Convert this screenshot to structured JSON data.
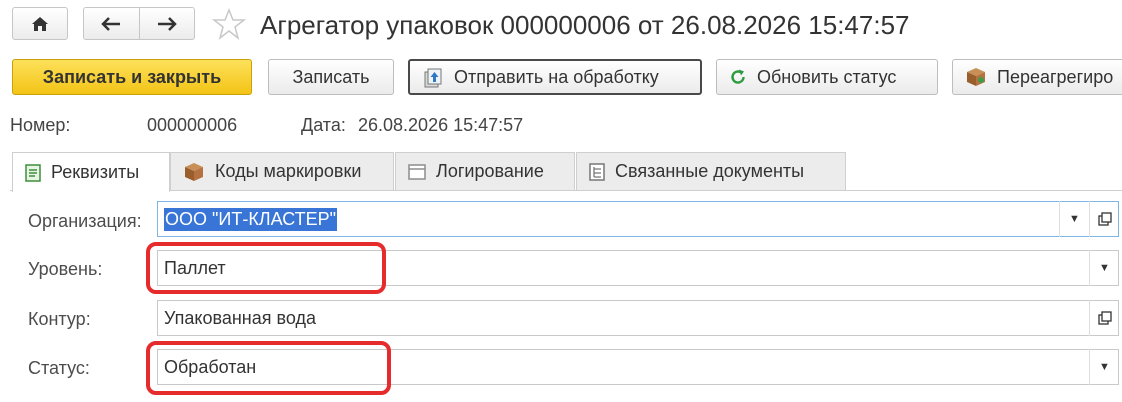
{
  "window": {
    "title": "Агрегатор упаковок 000000006 от 26.08.2026 15:47:57"
  },
  "nav": {
    "home_icon": "home-icon",
    "back_icon": "arrow-left-icon",
    "forward_icon": "arrow-right-icon",
    "favorite_icon": "star-icon"
  },
  "toolbar": {
    "save_close_label": "Записать и закрыть",
    "save_label": "Записать",
    "send_label": "Отправить на обработку",
    "refresh_label": "Обновить статус",
    "reaggregate_label": "Переагрегиро"
  },
  "header": {
    "number_label": "Номер:",
    "number_value": "000000006",
    "date_label": "Дата:",
    "date_value": "26.08.2026 15:47:57"
  },
  "tabs": [
    {
      "label": "Реквизиты",
      "icon": "form-icon"
    },
    {
      "label": "Коды маркировки",
      "icon": "box-icon"
    },
    {
      "label": "Логирование",
      "icon": "log-icon"
    },
    {
      "label": "Связанные документы",
      "icon": "documents-icon"
    }
  ],
  "form": {
    "organization_label": "Организация:",
    "organization_value": "ООО \"ИТ-КЛАСТЕР\"",
    "level_label": "Уровень:",
    "level_value": "Паллет",
    "contour_label": "Контур:",
    "contour_value": "Упакованная вода",
    "status_label": "Статус:",
    "status_value": "Обработан"
  },
  "colors": {
    "primary_button": "#f3c416",
    "highlight": "#e52b2b",
    "selection": "#3875d7"
  }
}
